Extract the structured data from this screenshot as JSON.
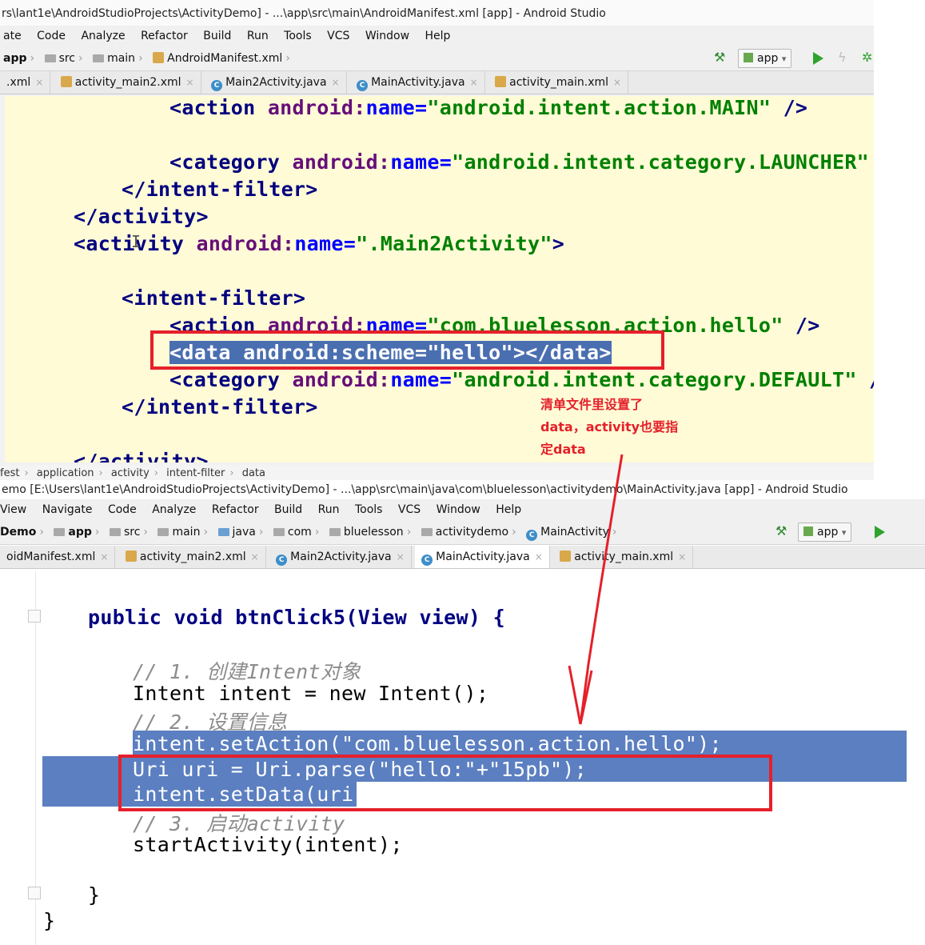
{
  "top_window": {
    "title": "rs\\lant1e\\AndroidStudioProjects\\ActivityDemo] - ...\\app\\src\\main\\AndroidManifest.xml [app] - Android Studio",
    "menu": [
      "ate",
      "Code",
      "Analyze",
      "Refactor",
      "Build",
      "Run",
      "Tools",
      "VCS",
      "Window",
      "Help"
    ],
    "breadcrumb": [
      "app",
      "src",
      "main",
      "AndroidManifest.xml"
    ],
    "run_config": "app",
    "tabs": [
      {
        "label": ".xml",
        "active": false
      },
      {
        "label": "activity_main2.xml",
        "active": false
      },
      {
        "label": "Main2Activity.java",
        "active": false
      },
      {
        "label": "MainActivity.java",
        "active": false
      },
      {
        "label": "activity_main.xml",
        "active": false
      }
    ],
    "code": [
      "<action android:name=\"android.intent.action.MAIN\" />",
      "<category android:name=\"android.intent.category.LAUNCHER\"",
      "</intent-filter>",
      "</activity>",
      "<activity android:name=\".Main2Activity\">",
      "<intent-filter>",
      "<action android:name=\"com.bluelesson.action.hello\" />",
      "<data android:scheme=\"hello\"></data>",
      "<category android:name=\"android.intent.category.DEFAULT\" /",
      "</intent-filter>",
      "</activity>"
    ],
    "status_crumb": [
      "fest",
      "application",
      "activity",
      "intent-filter",
      "data"
    ]
  },
  "bottom_window": {
    "title": "emo [E:\\Users\\lant1e\\AndroidStudioProjects\\ActivityDemo] - ...\\app\\src\\main\\java\\com\\bluelesson\\activitydemo\\MainActivity.java [app] - Android Studio",
    "menu": [
      "View",
      "Navigate",
      "Code",
      "Analyze",
      "Refactor",
      "Build",
      "Run",
      "Tools",
      "VCS",
      "Window",
      "Help"
    ],
    "breadcrumb": [
      "Demo",
      "app",
      "src",
      "main",
      "java",
      "com",
      "bluelesson",
      "activitydemo",
      "MainActivity"
    ],
    "run_config": "app",
    "tabs": [
      {
        "label": "oidManifest.xml",
        "active": false
      },
      {
        "label": "activity_main2.xml",
        "active": false
      },
      {
        "label": "Main2Activity.java",
        "active": false
      },
      {
        "label": "MainActivity.java",
        "active": true
      },
      {
        "label": "activity_main.xml",
        "active": false
      }
    ],
    "code": {
      "method_sig": "public void btnClick5(View view) {",
      "comment1": "// 1. 创建Intent对象",
      "line_new_intent": "Intent intent = new Intent();",
      "comment2": "// 2. 设置信息",
      "line_set_action": "intent.setAction(\"com.bluelesson.action.hello\");",
      "line_uri": "Uri uri = Uri.parse(\"hello:\"+\"15pb\");",
      "line_set_data": "intent.setData(uri);",
      "comment3": "// 3. 启动activity",
      "line_start": "startActivity(intent);",
      "close_method": "}",
      "close_class": "}"
    }
  },
  "annotation": {
    "note_lines": [
      "清单文件里设置了",
      "data，activity也要指",
      "定data"
    ],
    "color": "#e5202a"
  }
}
